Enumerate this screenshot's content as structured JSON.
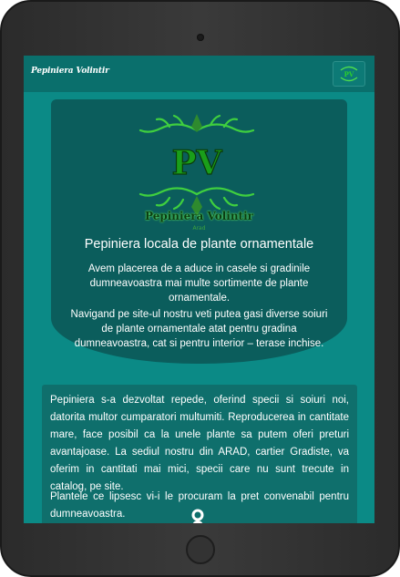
{
  "navbar": {
    "brand": "Pepiniera Volintir",
    "toggle_icon": "logo-thumbnail-icon"
  },
  "hero": {
    "logo_monogram": "PV",
    "logo_title": "Pepiniera Volintir",
    "logo_subtitle": "Arad",
    "heading": "Pepiniera locala de plante ornamentale",
    "paragraph_1": "Avem placerea de a aduce in casele si gradinile dumneavoastra mai multe sortimente de plante ornamentale.",
    "paragraph_2": "Navigand pe site-ul nostru veti putea gasi diverse soiuri de plante ornamentale atat pentru gradina dumneavoastra, cat si pentru interior – terase inchise."
  },
  "about": {
    "paragraph_1": "Pepiniera s-a dezvoltat repede, oferind specii si soiuri noi, datorita multor cumparatori multumiti. Reproducerea in cantitate mare, face posibil ca la unele plante sa putem oferi preturi avantajoase. La sediul nostru din ARAD, cartier Gradiste, va oferim in cantitati mai mici, specii care nu sunt trecute in catalog, pe site.",
    "paragraph_2": "Plantele ce lipsesc vi-i le procuram la pret convenabil pentru dumneavoastra."
  },
  "colors": {
    "screen_bg": "#0b8a86",
    "navbar_bg": "#0a6f6c",
    "hero_bg": "#0b5d5c",
    "about_bg": "#0f6f6c",
    "logo_green": "#4ddc4d"
  }
}
